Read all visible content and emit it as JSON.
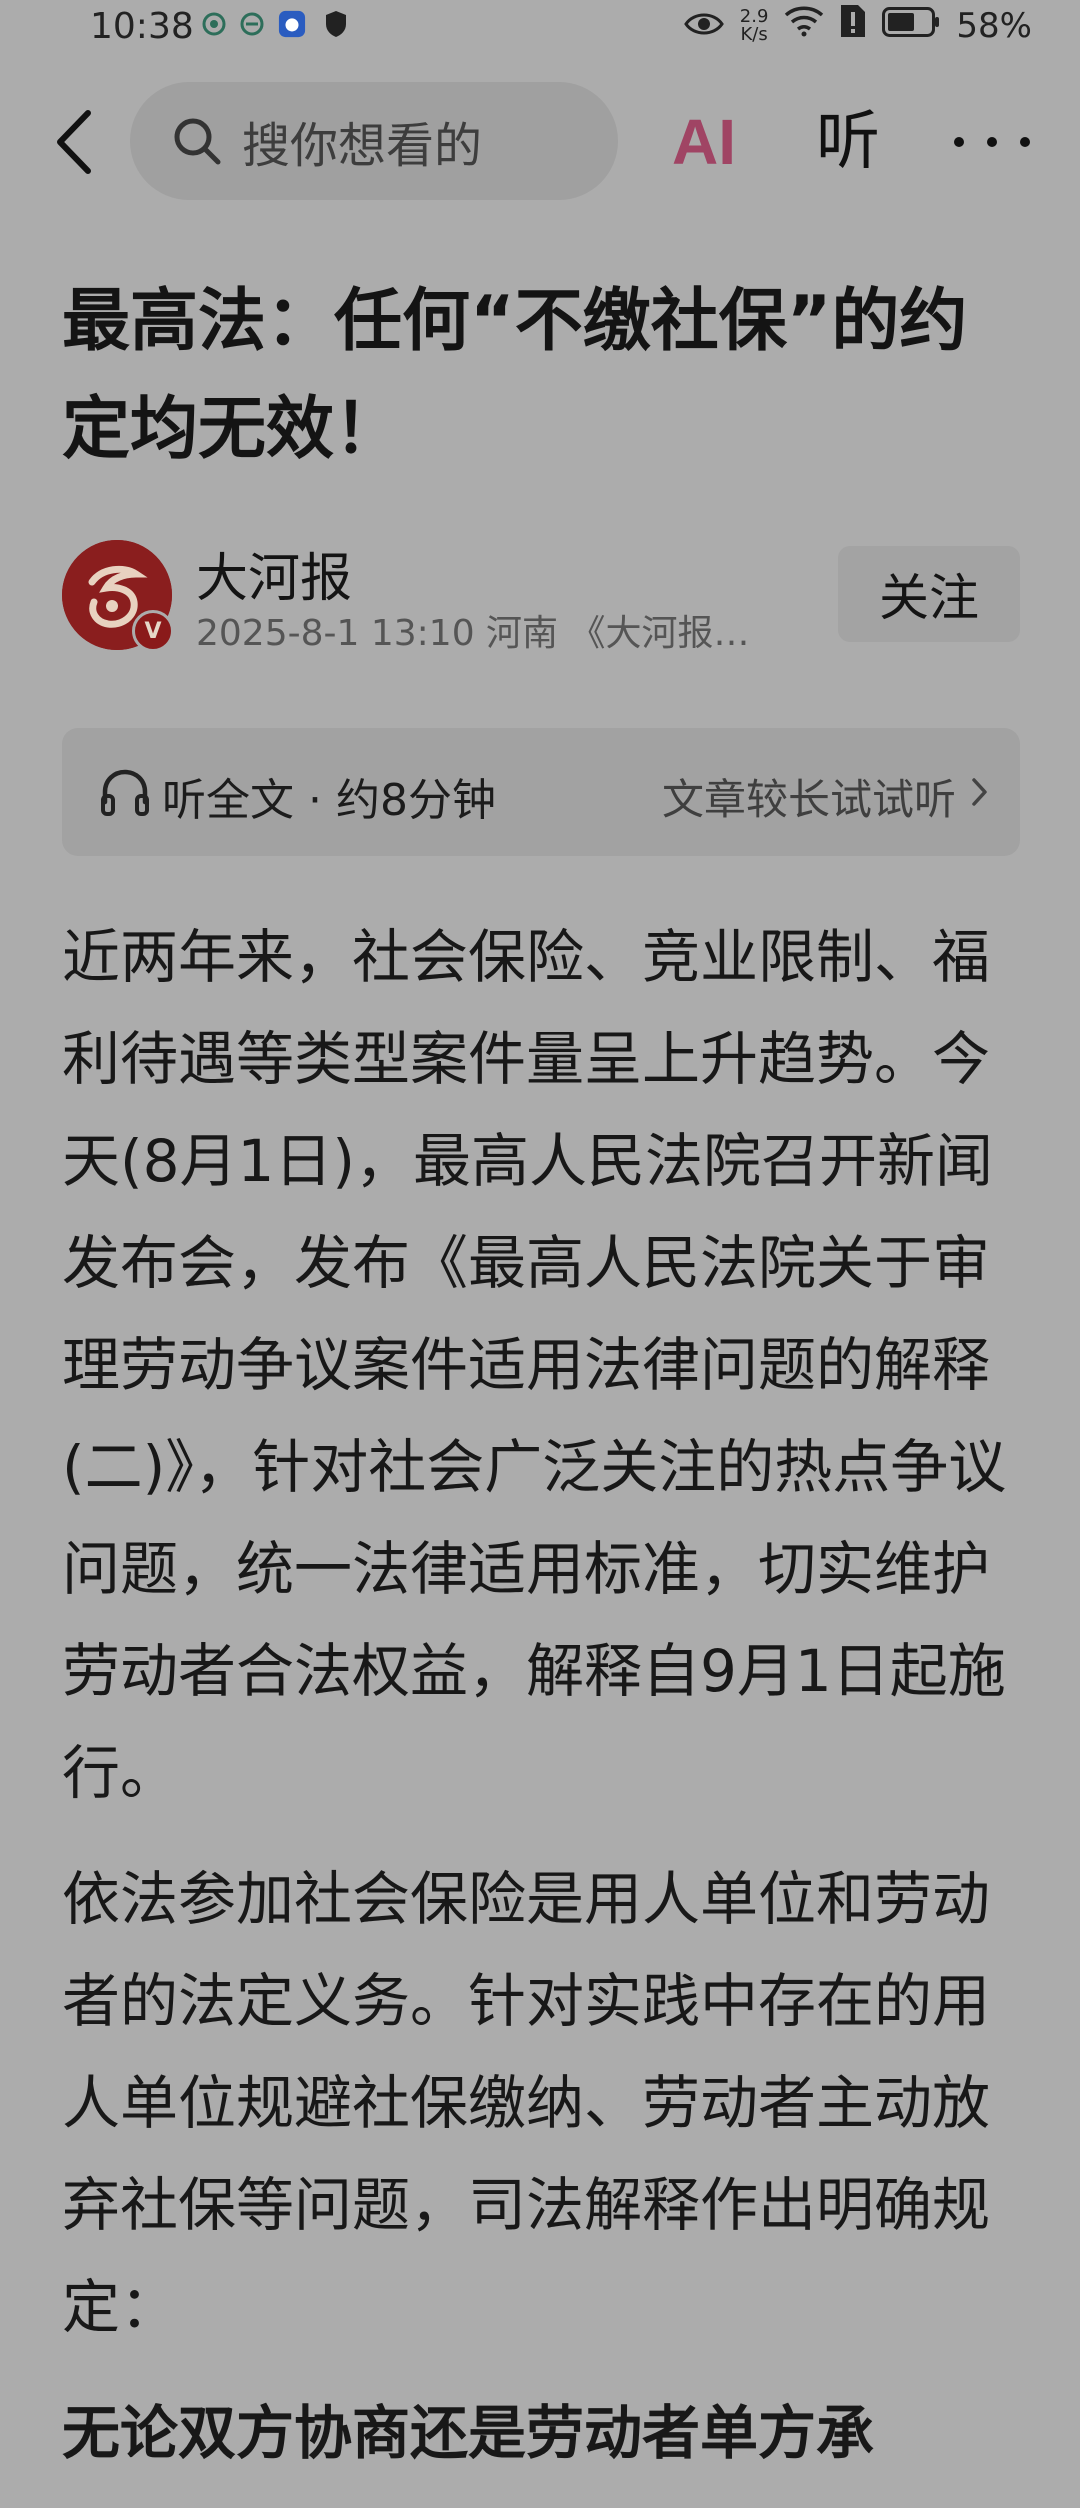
{
  "status_bar": {
    "time": "10:38",
    "net_speed_value": "2.9",
    "net_speed_unit": "K/s",
    "battery": "58%"
  },
  "nav": {
    "search_placeholder": "搜你想看的",
    "ai_label": "AI",
    "listen_label": "听"
  },
  "article": {
    "title": "最高法：任何“不缴社保”的约定均无效！",
    "author": {
      "name": "大河报",
      "meta": "2025-8-1  13:10  河南  《大河报…",
      "follow_label": "关注"
    },
    "listen_bar": {
      "label": "听全文 · 约8分钟",
      "hint": "文章较长试试听"
    },
    "paragraphs": [
      "近两年来，社会保险、竞业限制、福利待遇等类型案件量呈上升趋势。今天(8月1日)，最高人民法院召开新闻发布会，发布《最高人民法院关于审理劳动争议案件适用法律问题的解释(二)》，针对社会广泛关注的热点争议问题，统一法律适用标准，切实维护劳动者合法权益，解释自9月1日起施行。",
      "依法参加社会保险是用人单位和劳动者的法定义务。针对实践中存在的用人单位规避社保缴纳、劳动者主动放弃社保等问题，司法解释作出明确规定：",
      "无论双方协商还是劳动者单方承"
    ]
  },
  "colors": {
    "page_bg": "#acacac",
    "ai_accent": "#a04464",
    "brand_red": "#8a1e1e"
  }
}
